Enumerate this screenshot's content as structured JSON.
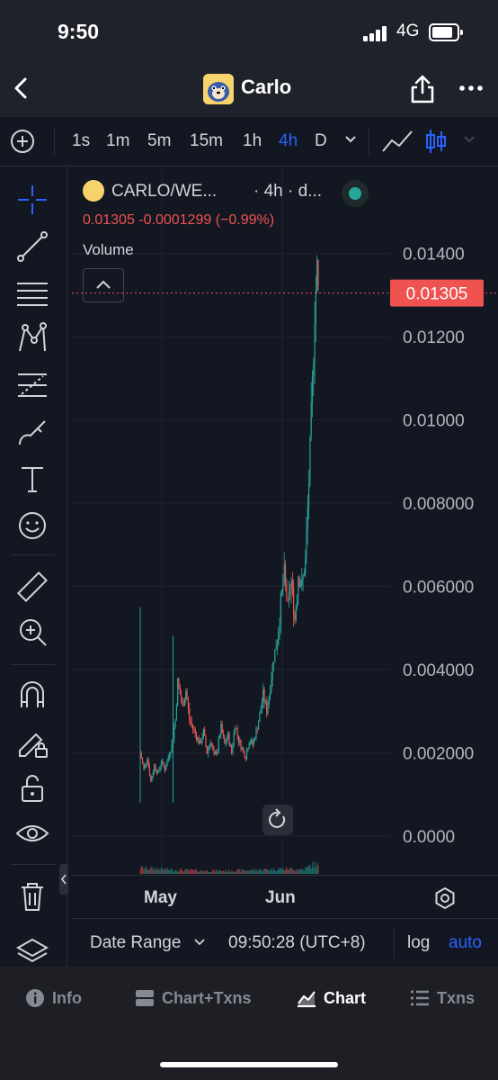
{
  "status": {
    "time": "9:50",
    "network": "4G"
  },
  "nav": {
    "title": "Carlo"
  },
  "toolbar": {
    "intervals": [
      "1s",
      "1m",
      "5m",
      "15m",
      "1h",
      "4h",
      "D"
    ],
    "active_interval": "4h"
  },
  "legend": {
    "pair": "CARLO/WE...",
    "interval": "· 4h · d...",
    "ohlc": "0.01305  -0.0001299 (−0.99%)",
    "volume_label": "Volume"
  },
  "chart_data": {
    "type": "candlestick",
    "title": "",
    "xlabel": "",
    "ylabel": "",
    "ylim": [
      -0.0002,
      0.0146
    ],
    "y_ticks": [
      "0.01400",
      "0.01200",
      "0.01000",
      "0.008000",
      "0.006000",
      "0.004000",
      "0.002000",
      "0.0000"
    ],
    "y_tick_values": [
      0.014,
      0.012,
      0.01,
      0.008,
      0.006,
      0.004,
      0.002,
      0.0
    ],
    "x_ticks": [
      "May",
      "Jun"
    ],
    "last_price": 0.01305,
    "last_price_label": "0.01305",
    "price_path": [
      [
        0,
        0.002
      ],
      [
        3,
        0.0016
      ],
      [
        6,
        0.0019
      ],
      [
        9,
        0.0013
      ],
      [
        12,
        0.0017
      ],
      [
        15,
        0.0015
      ],
      [
        18,
        0.0018
      ],
      [
        21,
        0.0016
      ],
      [
        24,
        0.0019
      ],
      [
        27,
        0.0022
      ],
      [
        30,
        0.0028
      ],
      [
        32,
        0.0037
      ],
      [
        34,
        0.0034
      ],
      [
        36,
        0.0031
      ],
      [
        39,
        0.0035
      ],
      [
        42,
        0.0028
      ],
      [
        45,
        0.0026
      ],
      [
        48,
        0.0024
      ],
      [
        51,
        0.0022
      ],
      [
        54,
        0.0025
      ],
      [
        57,
        0.002
      ],
      [
        60,
        0.0023
      ],
      [
        63,
        0.0019
      ],
      [
        66,
        0.0021
      ],
      [
        69,
        0.0026
      ],
      [
        72,
        0.0022
      ],
      [
        75,
        0.0024
      ],
      [
        78,
        0.002
      ],
      [
        81,
        0.0027
      ],
      [
        84,
        0.0023
      ],
      [
        87,
        0.0021
      ],
      [
        90,
        0.0019
      ],
      [
        93,
        0.0023
      ],
      [
        96,
        0.0022
      ],
      [
        99,
        0.0025
      ],
      [
        102,
        0.0029
      ],
      [
        105,
        0.0034
      ],
      [
        108,
        0.003
      ],
      [
        111,
        0.0036
      ],
      [
        114,
        0.0043
      ],
      [
        117,
        0.0047
      ],
      [
        120,
        0.0056
      ],
      [
        123,
        0.0063
      ],
      [
        126,
        0.0055
      ],
      [
        129,
        0.0061
      ],
      [
        132,
        0.0052
      ],
      [
        135,
        0.0063
      ],
      [
        138,
        0.006
      ],
      [
        141,
        0.0066
      ],
      [
        144,
        0.0085
      ],
      [
        147,
        0.0108
      ],
      [
        149,
        0.0127
      ],
      [
        151,
        0.0136
      ],
      [
        152,
        0.01305
      ]
    ],
    "spikes": [
      [
        0,
        0.0055
      ],
      [
        28,
        0.0048
      ]
    ],
    "volume": [
      [
        0,
        0.6
      ],
      [
        30,
        0.4
      ],
      [
        60,
        0.3
      ],
      [
        90,
        0.35
      ],
      [
        120,
        0.5
      ],
      [
        140,
        0.45
      ],
      [
        149,
        1.0
      ],
      [
        152,
        0.8
      ]
    ]
  },
  "xaxis": {
    "may": "May",
    "jun": "Jun"
  },
  "controls": {
    "date_range": "Date Range",
    "clock": "09:50:28 (UTC+8)",
    "log": "log",
    "auto": "auto"
  },
  "tabs": [
    {
      "label": "Info",
      "icon": "info-icon"
    },
    {
      "label": "Chart+Txns",
      "icon": "chart-txns-icon"
    },
    {
      "label": "Chart",
      "icon": "chart-icon"
    },
    {
      "label": "Txns",
      "icon": "list-icon"
    }
  ],
  "colors": {
    "up": "#26a69a",
    "down": "#ef5350",
    "accent": "#2962ff",
    "background": "#131722"
  }
}
